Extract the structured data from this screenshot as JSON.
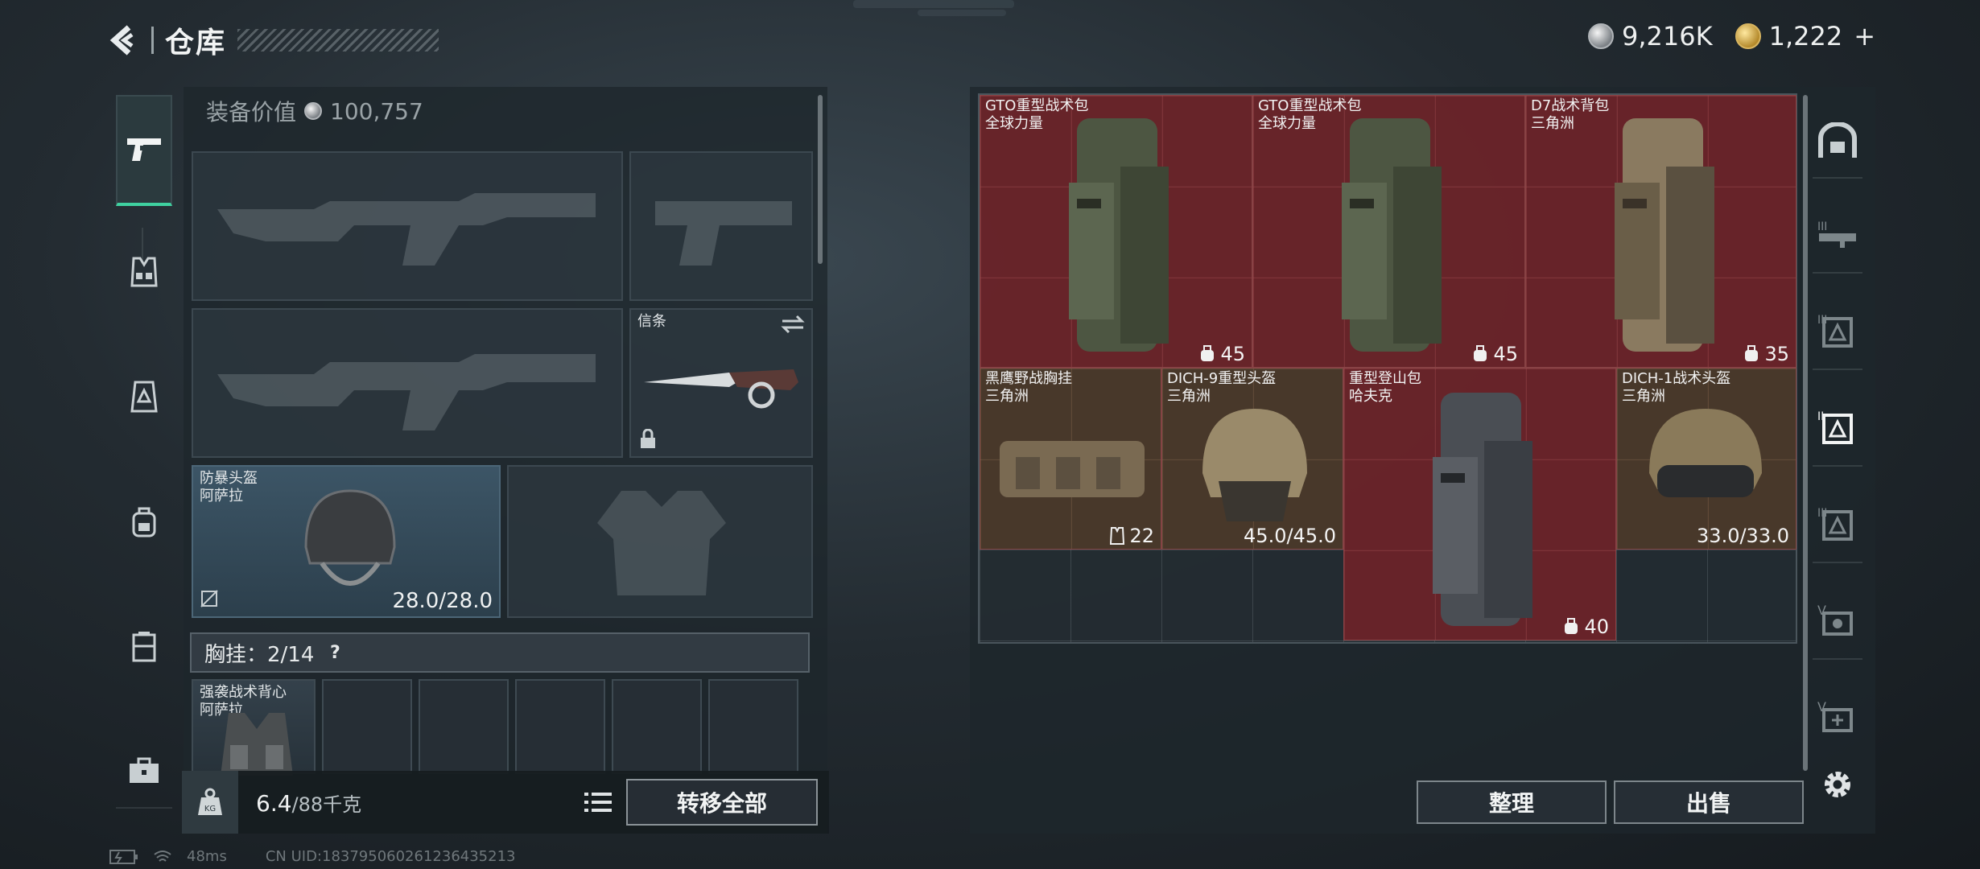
{
  "header": {
    "title": "仓库",
    "currency_silver": "9,216K",
    "currency_gold": "1,222",
    "gold_plus": "+"
  },
  "left_panel": {
    "equip_value_label": "装备价值",
    "equip_value": "100,757",
    "knife_slot_label": "信条",
    "helmet": {
      "name": "防暴头盔",
      "brand": "阿萨拉",
      "durability": "28.0/28.0"
    },
    "rig_header_label": "胸挂：",
    "rig_header_count": "2/14",
    "rig_help": "?",
    "rig_item": {
      "name": "强袭战术背心",
      "brand": "阿萨拉"
    },
    "weight": "6.4",
    "weight_max": "/88千克",
    "transfer_all": "转移全部"
  },
  "right_panel": {
    "items": [
      {
        "name": "GTO重型战术包",
        "brand": "全球力量",
        "tag": "45"
      },
      {
        "name": "GTO重型战术包",
        "brand": "全球力量",
        "tag": "45"
      },
      {
        "name": "D7战术背包",
        "brand": "三角洲",
        "tag": "35"
      },
      {
        "name": "黑鹰野战胸挂",
        "brand": "三角洲",
        "tag": "22"
      },
      {
        "name": "DICH-9重型头盔",
        "brand": "三角洲",
        "tag": "45.0/45.0"
      },
      {
        "name": "重型登山包",
        "brand": "哈夫克",
        "tag": "40"
      },
      {
        "name": "DICH-1战术头盔",
        "brand": "三角洲",
        "tag": "33.0/33.0"
      }
    ],
    "sort_label": "整理",
    "sell_label": "出售"
  },
  "status": {
    "ping": "48ms",
    "uid": "CN UID:183795060261236435213"
  },
  "colors": {
    "accent_green": "#3fd1a0",
    "item_red": "#76222a",
    "item_brown": "#4c3a2a"
  }
}
